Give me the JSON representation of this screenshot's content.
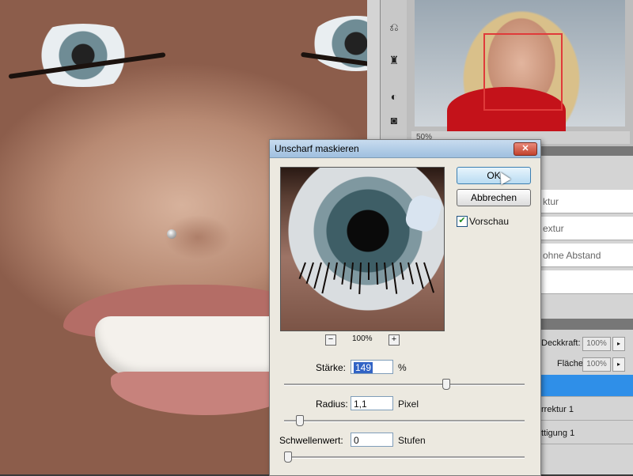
{
  "dialog": {
    "title": "Unscharf maskieren",
    "close_symbol": "✕",
    "buttons": {
      "ok": "OK",
      "cancel": "Abbrechen"
    },
    "preview": {
      "label": "Vorschau",
      "checked": true,
      "zoom": "100%",
      "zoom_out": "−",
      "zoom_in": "+"
    },
    "params": [
      {
        "label": "Stärke:",
        "value": "149",
        "unit": "%",
        "slider_fraction": 0.68
      },
      {
        "label": "Radius:",
        "value": "1,1",
        "unit": "Pixel",
        "slider_fraction": 0.05
      },
      {
        "label": "Schwellenwert:",
        "value": "0",
        "unit": "Stufen",
        "slider_fraction": 0.0
      }
    ]
  },
  "navigator": {
    "zoom_label": "50%"
  },
  "history_panel": {
    "rows": [
      "ktur",
      "extur",
      "ohne Abstand",
      ""
    ]
  },
  "layers_panel": {
    "opacity": {
      "label": "Deckkraft:",
      "value": "100%"
    },
    "fill": {
      "label": "Fläche:",
      "value": "100%"
    },
    "layers": [
      "",
      "rrektur 1",
      "ttigung 1"
    ]
  },
  "icons": [
    "close-icon",
    "checkbox-check-icon",
    "zoom-out-icon",
    "zoom-in-icon",
    "cursor-pointer-icon",
    "dropdown-arrow-icon"
  ]
}
